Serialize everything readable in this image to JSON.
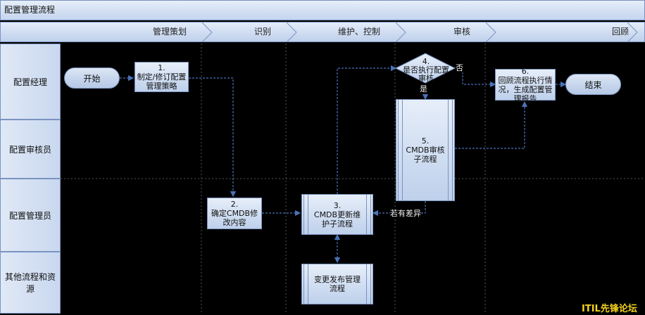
{
  "title": "配置管理流程",
  "phases": [
    "管理策划",
    "识别",
    "维护、控制",
    "审核",
    "回顾"
  ],
  "lanes": [
    "配置经理",
    "配置审核员",
    "配置管理员",
    "其他流程和资源"
  ],
  "nodes": {
    "start": "开始",
    "n1_num": "1.",
    "n1_text": "制定/修订配置管理策略",
    "n2_num": "2.",
    "n2_text": "确定CMDB修改内容",
    "n3_num": "3.",
    "n3_text": "CMDB更新维护子流程",
    "n4_num": "4.",
    "n4_text": "是否执行配置审核",
    "n5_num": "5.",
    "n5_text": "CMDB审核子流程",
    "n6_num": "6.",
    "n6_text": "回顾流程执行情况，生成配置管理报告",
    "change": "变更发布管理流程",
    "end": "结束"
  },
  "edge_labels": {
    "no": "否",
    "yes": "是",
    "diff": "若有差异"
  },
  "watermark": "ITIL先锋论坛",
  "colors": {
    "line": "#4a72b8",
    "shape_fill": "#c9d8ef",
    "border": "#7a93c0",
    "watermark": "#f3d21c"
  }
}
